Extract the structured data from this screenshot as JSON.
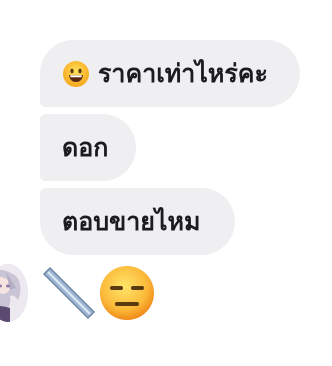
{
  "messages": [
    {
      "text": "ราคาเท่าไหร่คะ",
      "leading_emoji": "grinning-face-icon"
    },
    {
      "text": "ดอก"
    },
    {
      "text": "ตอบขายไหม"
    }
  ],
  "stickers": [
    "slash-sticker-icon",
    "expressionless-face-icon"
  ],
  "avatar": "user-avatar-anime-character"
}
